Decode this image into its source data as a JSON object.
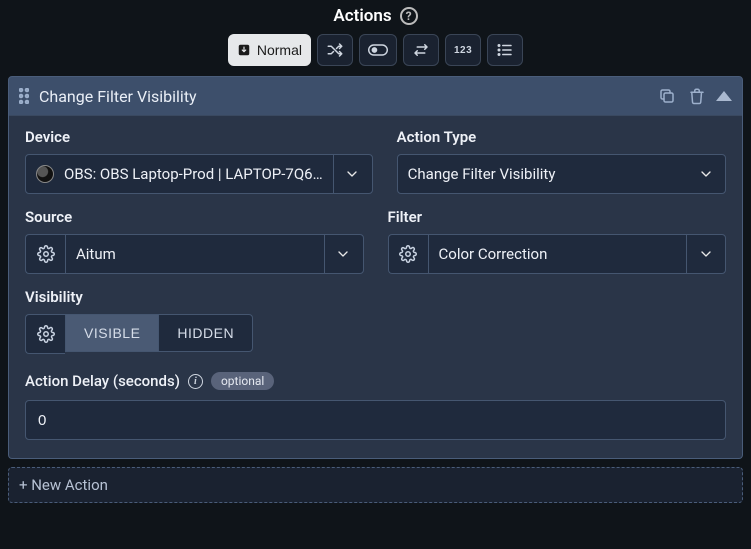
{
  "header": {
    "title": "Actions"
  },
  "toolbar": {
    "normal_label": "Normal",
    "num_label": "123"
  },
  "card": {
    "title": "Change Filter Visibility",
    "device_label": "Device",
    "device_value": "OBS: OBS Laptop-Prod | LAPTOP-7Q6…",
    "action_type_label": "Action Type",
    "action_type_value": "Change Filter Visibility",
    "source_label": "Source",
    "source_value": "Aitum",
    "filter_label": "Filter",
    "filter_value": "Color Correction",
    "visibility_label": "Visibility",
    "visibility_options": {
      "visible": "VISIBLE",
      "hidden": "HIDDEN"
    },
    "delay_label": "Action Delay (seconds)",
    "delay_optional": "optional",
    "delay_value": "0"
  },
  "footer": {
    "new_action": "+ New Action"
  }
}
